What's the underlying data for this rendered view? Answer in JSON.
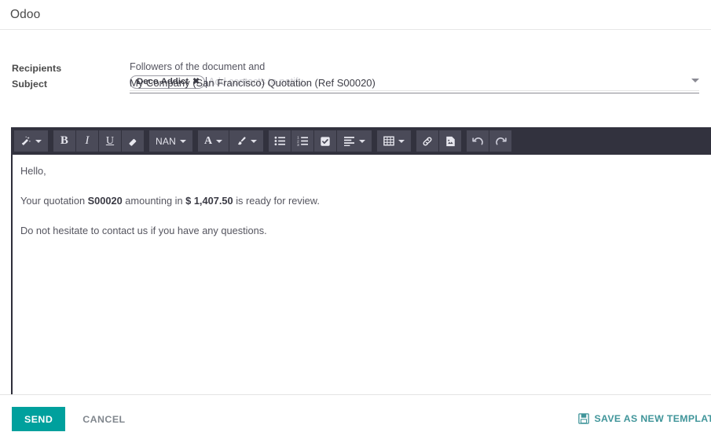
{
  "header": {
    "title": "Odoo"
  },
  "form": {
    "recipients": {
      "label": "Recipients",
      "followers_text": "Followers of the document and",
      "tags": [
        {
          "label": "Deco Addict",
          "remove_glyph": "✖"
        }
      ],
      "placeholder": "Add contacts to notify...",
      "dropdown_icon": "chevron-down-icon"
    },
    "subject": {
      "label": "Subject",
      "value": "My Company (San Francisco) Quotation (Ref S00020)"
    }
  },
  "toolbar": {
    "groups": [
      {
        "name": "snippets",
        "buttons": [
          {
            "name": "magic-wand-button",
            "icon": "magic-wand-icon",
            "label": "",
            "caret": true
          }
        ]
      },
      {
        "name": "text-style",
        "buttons": [
          {
            "name": "bold-button",
            "icon": "bold-icon",
            "label": "B",
            "caret": false
          },
          {
            "name": "italic-button",
            "icon": "italic-icon",
            "label": "I",
            "caret": false
          },
          {
            "name": "underline-button",
            "icon": "underline-icon",
            "label": "U",
            "caret": false
          },
          {
            "name": "remove-format-button",
            "icon": "eraser-icon",
            "label": "",
            "caret": false
          }
        ]
      },
      {
        "name": "font-size",
        "buttons": [
          {
            "name": "font-size-button",
            "icon": "",
            "label": "NAN",
            "caret": true
          }
        ]
      },
      {
        "name": "text-color",
        "buttons": [
          {
            "name": "font-color-button",
            "icon": "font-color-icon",
            "label": "A",
            "caret": true
          }
        ]
      },
      {
        "name": "background-color",
        "buttons": [
          {
            "name": "background-color-button",
            "icon": "paintbrush-icon",
            "label": "",
            "caret": true
          }
        ]
      },
      {
        "name": "lists",
        "buttons": [
          {
            "name": "unordered-list-button",
            "icon": "bullet-list-icon",
            "label": "",
            "caret": false
          },
          {
            "name": "ordered-list-button",
            "icon": "numbered-list-icon",
            "label": "",
            "caret": false
          },
          {
            "name": "checklist-button",
            "icon": "checklist-icon",
            "label": "",
            "caret": false
          },
          {
            "name": "align-button",
            "icon": "align-left-icon",
            "label": "",
            "caret": true
          }
        ]
      },
      {
        "name": "table",
        "buttons": [
          {
            "name": "table-button",
            "icon": "table-icon",
            "label": "",
            "caret": true
          }
        ]
      },
      {
        "name": "media",
        "buttons": [
          {
            "name": "link-button",
            "icon": "link-icon",
            "label": "",
            "caret": false
          },
          {
            "name": "image-button",
            "icon": "image-icon",
            "label": "",
            "caret": false
          }
        ]
      },
      {
        "name": "history",
        "buttons": [
          {
            "name": "undo-button",
            "icon": "undo-icon",
            "label": "",
            "caret": false
          },
          {
            "name": "redo-button",
            "icon": "redo-icon",
            "label": "",
            "caret": false
          }
        ]
      }
    ]
  },
  "body": {
    "paragraphs": [
      {
        "prefix": "Hello,",
        "bold1": "",
        "middle": "",
        "bold2": "",
        "suffix": ""
      },
      {
        "prefix": "Your quotation ",
        "bold1": "S00020",
        "middle": " amounting in ",
        "bold2": "$ 1,407.50",
        "suffix": " is ready for review."
      },
      {
        "prefix": "Do not hesitate to contact us if you have any questions.",
        "bold1": "",
        "middle": "",
        "bold2": "",
        "suffix": ""
      }
    ]
  },
  "footer": {
    "send_label": "SEND",
    "cancel_label": "CANCEL",
    "save_template_label": "SAVE AS NEW TEMPLATE",
    "save_template_icon": "floppy-disk-icon"
  },
  "colors": {
    "accent": "#00a09d",
    "toolbar_bg": "#32323e",
    "toolbar_button": "#4a4a58",
    "link_teal": "#40959a"
  }
}
